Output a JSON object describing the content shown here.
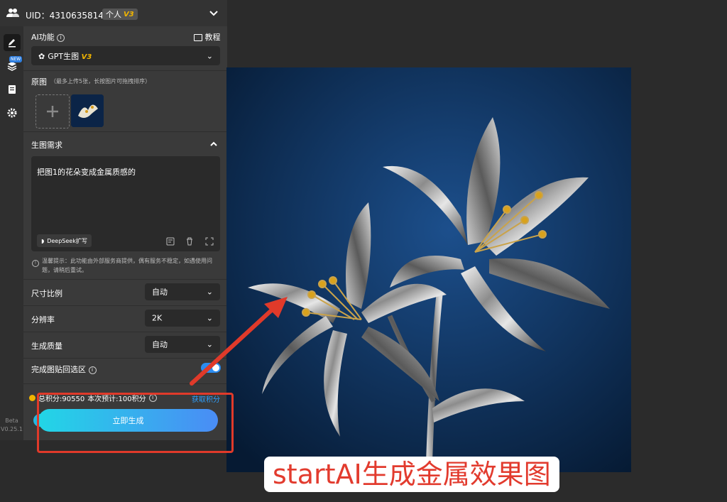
{
  "header": {
    "uid": "UID：4310635814",
    "account_type": "个人",
    "version_badge": "V3"
  },
  "rail": {
    "new_badge": "NEW",
    "beta_label": "Beta",
    "version": "V0.25.1"
  },
  "ai_function": {
    "label": "AI功能",
    "tutorial": "教程",
    "selected": "GPT生图",
    "selected_badge": "V3"
  },
  "source_image": {
    "label": "原图",
    "hint": "（最多上传5张，长按图片可拖拽排序）"
  },
  "prompt_section": {
    "label": "生图需求",
    "text": "把图1的花朵变成金属质感的",
    "deepseek": "DeepSeek扩写"
  },
  "tip": "温馨提示：此功能由外部服务商提供，偶有服务不稳定，如遇使用问题，请稍后重试。",
  "settings": [
    {
      "label": "尺寸比例",
      "value": "自动"
    },
    {
      "label": "分辨率",
      "value": "2K"
    },
    {
      "label": "生成质量",
      "value": "自动"
    }
  ],
  "paste_back": {
    "label": "完成图贴回选区",
    "enabled": true
  },
  "points": {
    "total": "总积分:90550",
    "estimate": "本次预计:100积分",
    "get_link": "获取积分"
  },
  "generate_button": "立即生成",
  "caption": "startAI生成金属效果图",
  "colors": {
    "accent_gradient_start": "#22d6e6",
    "accent_gradient_end": "#4a8cf5",
    "annotation_red": "#e03a2a",
    "badge_gold": "#f0b400"
  }
}
